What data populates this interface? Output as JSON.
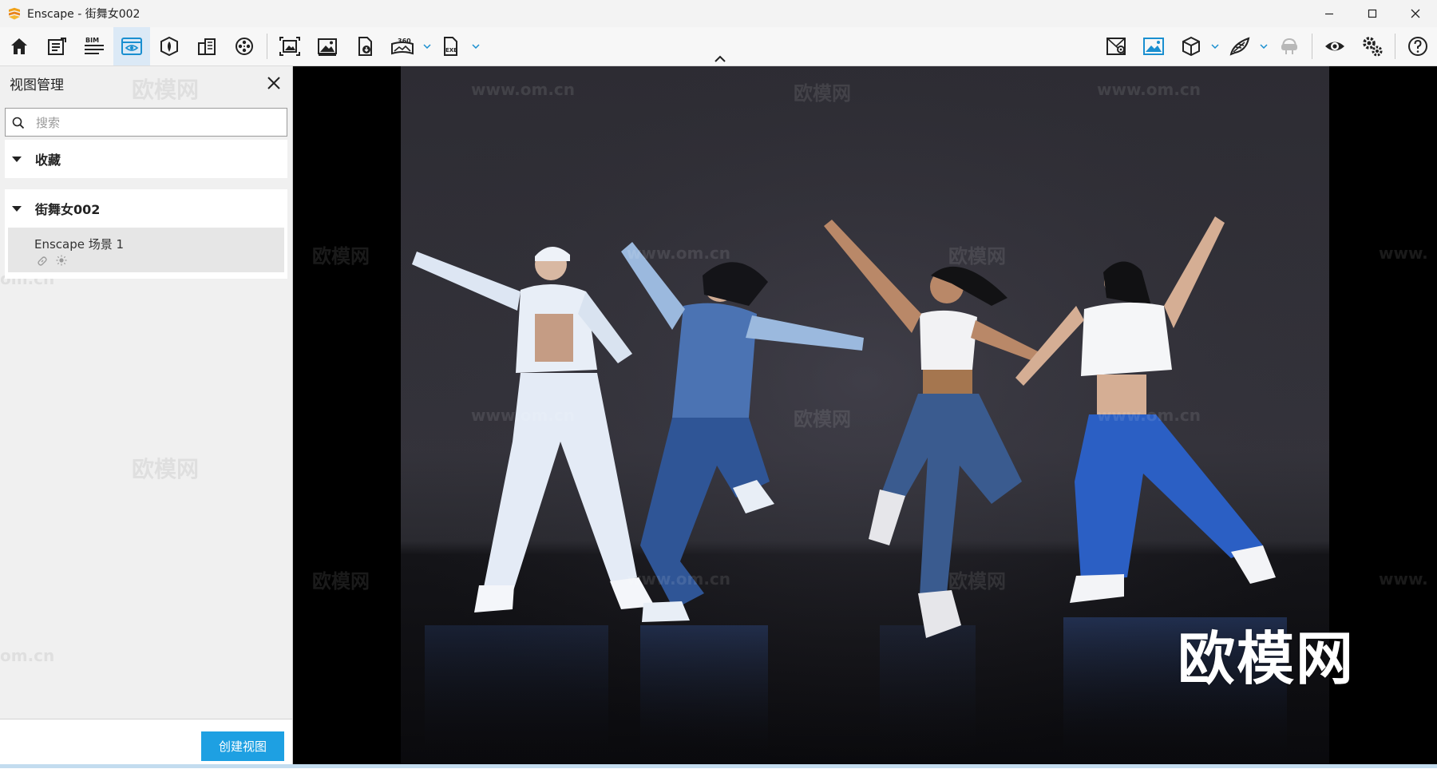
{
  "window": {
    "title": "Enscape - 街舞女002",
    "controls": [
      "minimize-icon",
      "maximize-icon",
      "close-icon"
    ]
  },
  "toolbar": {
    "left_icons": [
      "home-icon",
      "notes-icon",
      "bim-icon",
      "view-manager-icon",
      "assets-icon",
      "sites-icon",
      "video-editor-icon",
      "batch-render-icon",
      "screenshot-icon",
      "export-image-icon",
      "panorama-360-icon",
      "exe-export-icon"
    ],
    "bim_label": "BIM",
    "pano_label": "360",
    "exe_label": "EXE",
    "right_icons": [
      "minimap-icon",
      "visual-settings-icon",
      "cube-view-icon",
      "fly-mode-icon",
      "vr-headset-icon",
      "show-hide-icon",
      "settings-icon",
      "help-icon"
    ],
    "active_item": "view-manager-icon",
    "accent_color": "#1ea0e2"
  },
  "panel": {
    "title": "视图管理",
    "search": {
      "placeholder": "搜索",
      "value": ""
    },
    "sections": [
      {
        "label": "收藏",
        "expanded": true,
        "items": []
      },
      {
        "label": "街舞女002",
        "expanded": true,
        "items": [
          {
            "name": "Enscape 场景 1",
            "icons": [
              "link-icon",
              "sun-icon"
            ]
          }
        ]
      }
    ],
    "create_button": "创建视图"
  },
  "viewport": {
    "watermark_url": "www.om.cn",
    "watermark_brand": "欧模网",
    "watermark_fragment_left": "om.cn",
    "watermark_fragment_right": "www.",
    "brand_overlay": "欧模网"
  }
}
